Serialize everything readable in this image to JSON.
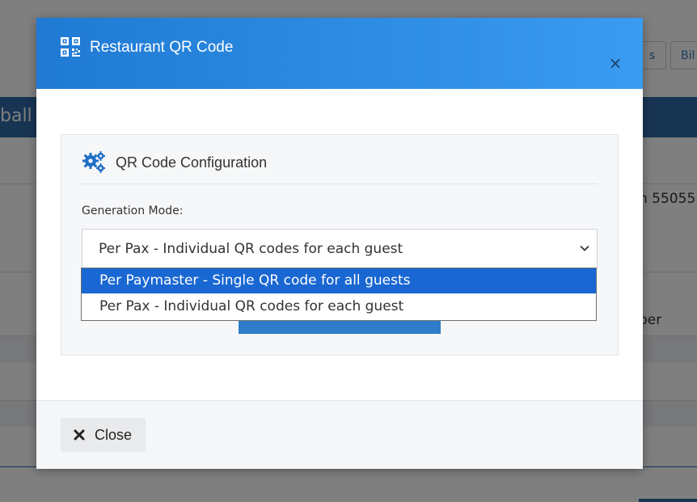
{
  "background": {
    "buttons": [
      "s",
      "Bil"
    ],
    "band_text": "ball",
    "row_texts": [
      "n 55055",
      "ber"
    ]
  },
  "modal": {
    "title": "Restaurant QR Code",
    "close_symbol": "×",
    "panel": {
      "title": "QR Code Configuration",
      "generation_label": "Generation Mode:",
      "select": {
        "value": "Per Pax - Individual QR codes for each guest",
        "options": [
          {
            "label": "Per Paymaster - Single QR code for all guests",
            "highlighted": true
          },
          {
            "label": "Per Pax - Individual QR codes for each guest",
            "highlighted": false
          }
        ]
      }
    },
    "footer": {
      "close_label": "Close"
    }
  },
  "icons": {
    "header": "qr-code-icon",
    "panel": "gears-icon",
    "select": "chevron-down-icon",
    "dismiss": "close-icon",
    "close_button": "times-icon"
  },
  "colors": {
    "header_gradient_start": "#1f7ad4",
    "header_gradient_end": "#3a9bf0",
    "option_highlight": "#1967d2",
    "accent_blue": "#2f7cc9"
  }
}
